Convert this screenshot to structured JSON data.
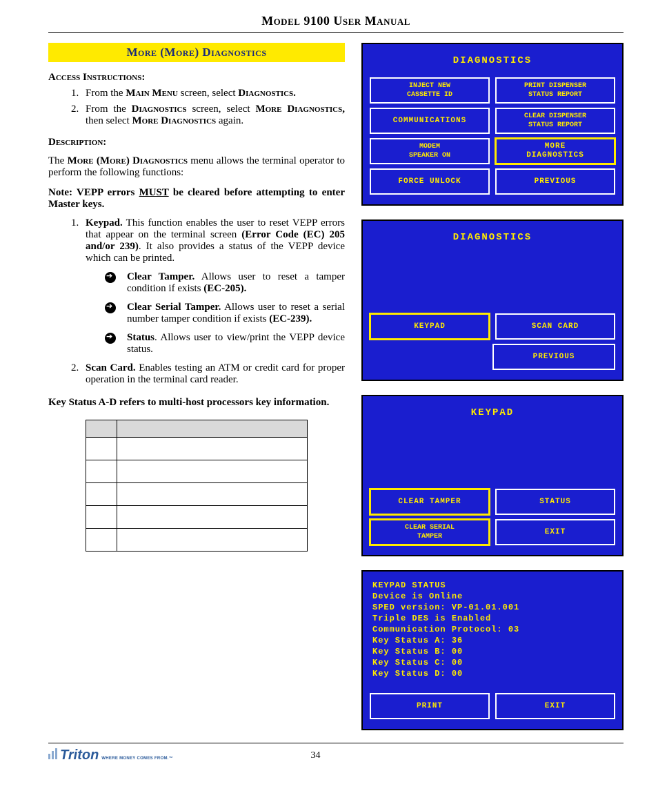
{
  "header": {
    "title": "Model 9100 User Manual"
  },
  "section": {
    "title": "More (More) Diagnostics"
  },
  "access": {
    "heading": "Access Instructions:",
    "steps": [
      {
        "pre": "From the ",
        "menu1": "Main Menu",
        "mid": " screen, select ",
        "menu2": "Diagnostics."
      },
      {
        "pre": "From the ",
        "menu1": "Diagnostics",
        "mid": " screen, select ",
        "menu2": "More Diagnostics,",
        "post1": " then select ",
        "menu3": "More Diagnostics",
        "post2": " again."
      }
    ]
  },
  "description": {
    "heading": "Description:",
    "intro_pre": "The ",
    "intro_bold": "More (More) Diagnostics",
    "intro_post": " menu allows the terminal operator to perform the following functions:"
  },
  "note": {
    "pre": "Note: VEPP errors ",
    "must": "MUST",
    "post": " be cleared before attempting to enter Master keys."
  },
  "functions": {
    "keypad": {
      "label": "Keypad.",
      "text1": " This function enables the user to reset VEPP errors that appear on the terminal screen ",
      "bold1": "(Error Code (EC) 205 and/or 239)",
      "text2": ". It also provides a status of the VEPP device which can be printed."
    },
    "clear_tamper": {
      "label": "Clear Tamper.",
      "text1": "  Allows user to reset a tamper condition if exists ",
      "bold1": "(EC-205)."
    },
    "clear_serial": {
      "label": "Clear Serial Tamper.",
      "text1": " Allows user to reset a serial number tamper condition if exists ",
      "bold1": "(EC-239)."
    },
    "status": {
      "label": "Status",
      "text1": ". Allows user to view/print the VEPP device status."
    },
    "scan_card": {
      "label": "Scan Card.",
      "text1": "  Enables testing an ATM or credit card for proper operation in the terminal card reader."
    }
  },
  "keynote": "Key Status A-D refers to multi-host processors key information.",
  "screens": {
    "s1": {
      "title": "DIAGNOSTICS",
      "b1": "INJECT NEW\nCASSETTE ID",
      "b2": "PRINT DISPENSER\nSTATUS REPORT",
      "b3": "COMMUNICATIONS",
      "b4": "CLEAR DISPENSER\nSTATUS REPORT",
      "b5": "MODEM\nSPEAKER    ON",
      "b6": "MORE\nDIAGNOSTICS",
      "b7": "FORCE UNLOCK",
      "b8": "PREVIOUS"
    },
    "s2": {
      "title": "DIAGNOSTICS",
      "b1": "KEYPAD",
      "b2": "SCAN CARD",
      "b3": "PREVIOUS"
    },
    "s3": {
      "title": "KEYPAD",
      "b1": "CLEAR TAMPER",
      "b2": "STATUS",
      "b3": "CLEAR SERIAL\nTAMPER",
      "b4": "EXIT"
    },
    "s4": {
      "lines": [
        "KEYPAD STATUS",
        "Device is Online",
        "SPED version: VP-01.01.001",
        "Triple DES is Enabled",
        "Communication Protocol: 03",
        "Key Status A: 36",
        "Key Status B: 00",
        "Key Status C: 00",
        "Key Status D: 00"
      ],
      "b1": "PRINT",
      "b2": "EXIT"
    }
  },
  "footer": {
    "logo": "Triton",
    "tagline": "WHERE MONEY COMES FROM.™",
    "page": "34"
  }
}
